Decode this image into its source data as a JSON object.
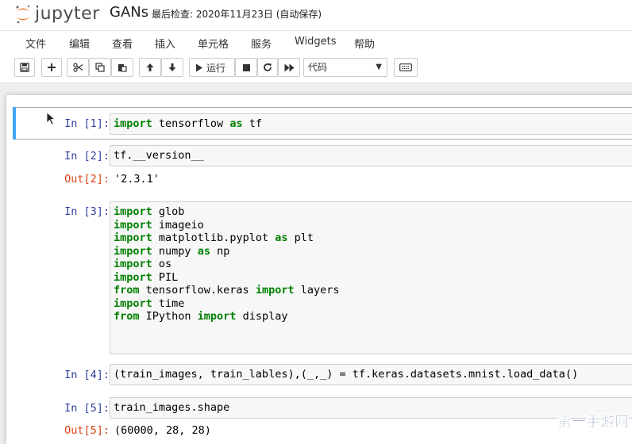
{
  "header": {
    "logo_text": "jupyter",
    "notebook_name": "GANs",
    "checkpoint": "最后检查: 2020年11月23日  (自动保存)"
  },
  "menubar": {
    "items": [
      "文件",
      "编辑",
      "查看",
      "插入",
      "单元格",
      "服务",
      "Widgets",
      "帮助"
    ]
  },
  "toolbar": {
    "run_label": "运行",
    "cell_type": "代码",
    "icons": [
      "save-icon",
      "plus-icon",
      "scissors-icon",
      "copy-icon",
      "paste-icon",
      "arrow-up-icon",
      "arrow-down-icon",
      "play-icon",
      "stop-icon",
      "restart-icon",
      "fast-forward-icon",
      "keyboard-icon"
    ]
  },
  "cells": [
    {
      "prompt": "In [1]:",
      "lines": [
        [
          [
            "kw",
            "import"
          ],
          [
            "t",
            " tensorflow "
          ],
          [
            "kw",
            "as"
          ],
          [
            "t",
            " tf"
          ]
        ]
      ]
    },
    {
      "prompt": "In [2]:",
      "lines": [
        [
          [
            "t",
            "tf.__version__"
          ]
        ]
      ],
      "out_prompt": "Out[2]:",
      "output": "'2.3.1'"
    },
    {
      "prompt": "In [3]:",
      "lines": [
        [
          [
            "kw",
            "import"
          ],
          [
            "t",
            " glob"
          ]
        ],
        [
          [
            "kw",
            "import"
          ],
          [
            "t",
            " imageio"
          ]
        ],
        [
          [
            "kw",
            "import"
          ],
          [
            "t",
            " matplotlib.pyplot "
          ],
          [
            "kw",
            "as"
          ],
          [
            "t",
            " plt"
          ]
        ],
        [
          [
            "kw",
            "import"
          ],
          [
            "t",
            " numpy "
          ],
          [
            "kw",
            "as"
          ],
          [
            "t",
            " np"
          ]
        ],
        [
          [
            "kw",
            "import"
          ],
          [
            "t",
            " os"
          ]
        ],
        [
          [
            "kw",
            "import"
          ],
          [
            "t",
            " PIL"
          ]
        ],
        [
          [
            "kw",
            "from"
          ],
          [
            "t",
            " tensorflow.keras "
          ],
          [
            "kw",
            "import"
          ],
          [
            "t",
            " layers"
          ]
        ],
        [
          [
            "kw",
            "import"
          ],
          [
            "t",
            " time"
          ]
        ],
        [
          [
            "kw",
            "from"
          ],
          [
            "t",
            " IPython "
          ],
          [
            "kw",
            "import"
          ],
          [
            "t",
            " display"
          ]
        ]
      ]
    },
    {
      "prompt": "In [4]:",
      "lines": [
        [
          [
            "t",
            "(train_images, train_lables),(_,_) = tf.keras.datasets.mnist.load_data()"
          ]
        ]
      ]
    },
    {
      "prompt": "In [5]:",
      "lines": [
        [
          [
            "t",
            "train_images.shape"
          ]
        ]
      ],
      "out_prompt": "Out[5]:",
      "output": "(60000, 28, 28)"
    }
  ],
  "watermark": "第一手游网"
}
